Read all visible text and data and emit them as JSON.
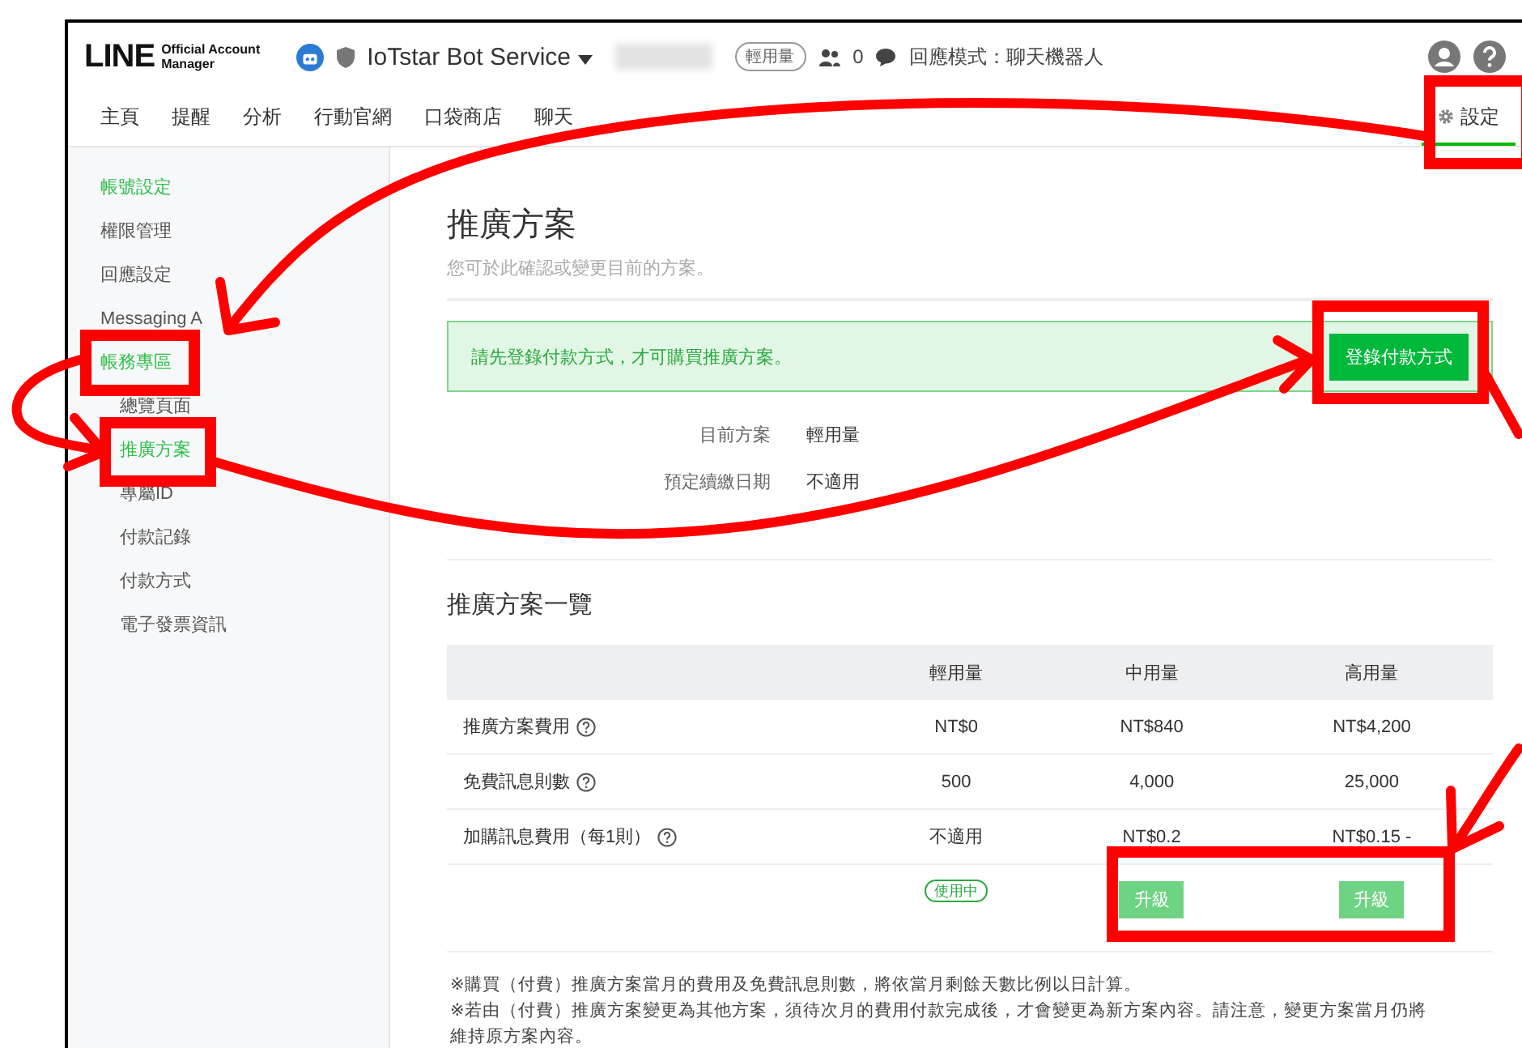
{
  "header": {
    "logo_main": "LINE",
    "logo_sub1": "Official Account",
    "logo_sub2": "Manager",
    "account_name": "IoTstar Bot Service",
    "plan_badge": "輕用量",
    "friends_count": "0",
    "response_mode": "回應模式：聊天機器人"
  },
  "nav": {
    "items": [
      {
        "label": "主頁",
        "selected": false
      },
      {
        "label": "提醒",
        "selected": false
      },
      {
        "label": "分析",
        "selected": false
      },
      {
        "label": "行動官網",
        "selected": false
      },
      {
        "label": "口袋商店",
        "selected": false
      },
      {
        "label": "聊天",
        "selected": false
      }
    ],
    "settings": {
      "label": "設定",
      "selected": true
    }
  },
  "sidebar": {
    "items": [
      {
        "label": "帳號設定",
        "selected": true
      },
      {
        "label": "權限管理",
        "selected": false
      },
      {
        "label": "回應設定",
        "selected": false
      },
      {
        "label": "Messaging A",
        "selected": false
      },
      {
        "label": "帳務專區",
        "selected": true,
        "children": [
          {
            "label": "總覽頁面",
            "selected": false
          },
          {
            "label": "推廣方案",
            "selected": true
          },
          {
            "label": "專屬ID",
            "selected": false
          },
          {
            "label": "付款記錄",
            "selected": false
          },
          {
            "label": "付款方式",
            "selected": false
          },
          {
            "label": "電子發票資訊",
            "selected": false
          }
        ]
      }
    ]
  },
  "page": {
    "title": "推廣方案",
    "subtitle": "您可於此確認或變更目前的方案。",
    "alert": {
      "message": "請先登錄付款方式，才可購買推廣方案。",
      "button": "登錄付款方式"
    },
    "info": [
      {
        "label": "目前方案",
        "value": "輕用量"
      },
      {
        "label": "預定續繳日期",
        "value": "不適用"
      }
    ],
    "section_title": "推廣方案一覽",
    "table": {
      "columns": [
        "輕用量",
        "中用量",
        "高用量"
      ],
      "rows": [
        {
          "label": "推廣方案費用",
          "cells": [
            "NT$0",
            "NT$840",
            "NT$4,200"
          ]
        },
        {
          "label": "免費訊息則數",
          "cells": [
            "500",
            "4,000",
            "25,000"
          ]
        },
        {
          "label": "加購訊息費用（每1則）",
          "cells": [
            "不適用",
            "NT$0.2",
            "NT$0.15 -"
          ]
        }
      ],
      "actions": [
        {
          "kind": "badge",
          "label": "使用中"
        },
        {
          "kind": "button",
          "label": "升級"
        },
        {
          "kind": "button",
          "label": "升級"
        }
      ]
    },
    "notes": [
      "※購買（付費）推廣方案當月的費用及免費訊息則數，將依當月剩餘天數比例以日計算。",
      "※若由（付費）推廣方案變更為其他方案，須待次月的費用付款完成後，才會變更為新方案內容。請注意，變更方案當月仍將維持原方案內容。"
    ]
  }
}
